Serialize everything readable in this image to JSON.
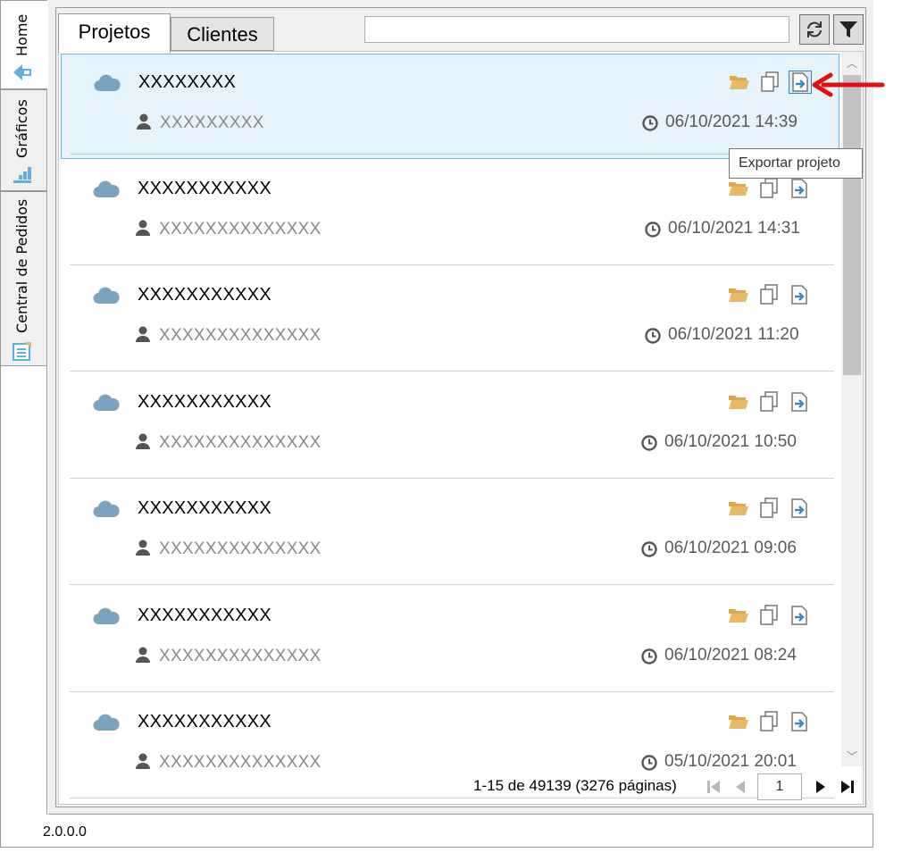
{
  "sidebar": {
    "tabs": [
      {
        "label": "Home",
        "icon": "home-icon"
      },
      {
        "label": "Gráficos",
        "icon": "bar-chart-icon"
      },
      {
        "label": "Central de Pedidos",
        "icon": "orders-icon"
      }
    ]
  },
  "tabs": {
    "projetos": "Projetos",
    "clientes": "Clientes"
  },
  "search": {
    "value": "",
    "placeholder": ""
  },
  "toolbar": {
    "refresh_icon": "refresh-icon",
    "filter_icon": "filter-icon"
  },
  "items": [
    {
      "name": "XXXXXXXX",
      "user": "XXXXXXXXX",
      "date": "06/10/2021 14:39",
      "selected": true
    },
    {
      "name": "XXXXXXXXXXX",
      "user": "XXXXXXXXXXXXXX",
      "date": "06/10/2021 14:31"
    },
    {
      "name": "XXXXXXXXXXX",
      "user": "XXXXXXXXXXXXXX",
      "date": "06/10/2021 11:20"
    },
    {
      "name": "XXXXXXXXXXX",
      "user": "XXXXXXXXXXXXXX",
      "date": "06/10/2021 10:50"
    },
    {
      "name": "XXXXXXXXXXX",
      "user": "XXXXXXXXXXXXXX",
      "date": "06/10/2021 09:06"
    },
    {
      "name": "XXXXXXXXXXX",
      "user": "XXXXXXXXXXXXXX",
      "date": "06/10/2021 08:24"
    },
    {
      "name": "XXXXXXXXXXX",
      "user": "XXXXXXXXXXXXXX",
      "date": "05/10/2021 20:01"
    }
  ],
  "tooltip": "Exportar projeto",
  "pager": {
    "info": "1-15 de 49139 (3276 páginas)",
    "current_page": "1"
  },
  "version": "2.0.0.0",
  "colors": {
    "selected_bg": "#e5f3fb",
    "selected_border": "#67b6e6",
    "cloud": "#7aa3c0",
    "folder": "#e8b865",
    "annotation": "#e01010"
  }
}
